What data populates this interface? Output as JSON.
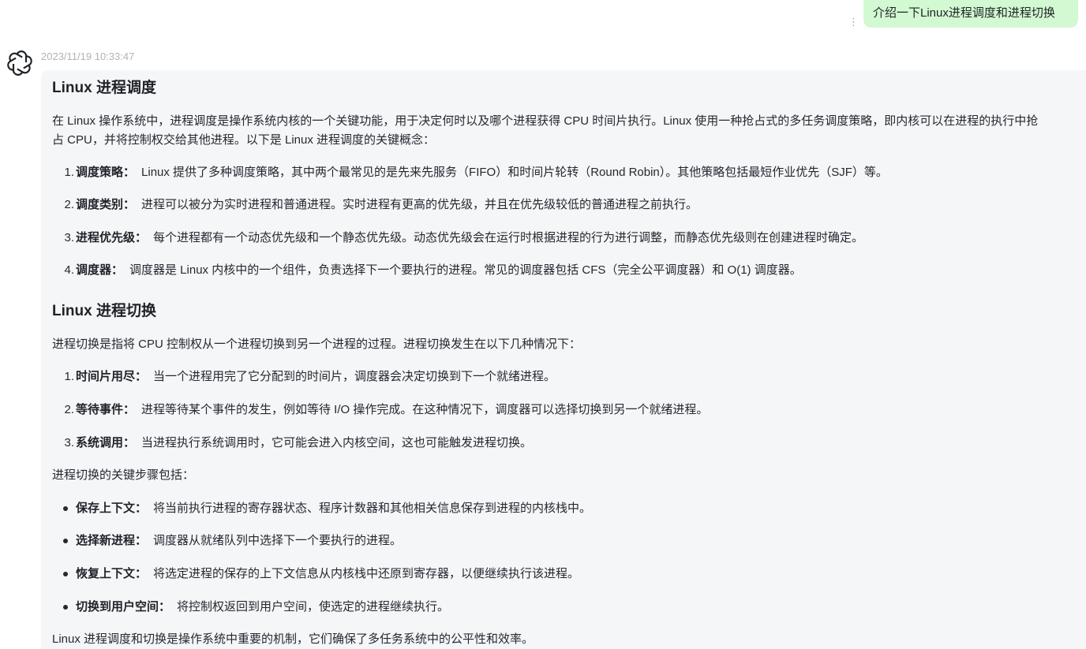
{
  "user_message": {
    "text": "介绍一下Linux进程调度和进程切换",
    "more_icon": "⋮"
  },
  "bot": {
    "timestamp": "2023/11/19 10:33:47",
    "avatar_icon": "openai-logo-icon",
    "h1": "Linux 进程调度",
    "p1_line1": "在 Linux 操作系统中，进程调度是操作系统内核的一个关键功能，用于决定何时以及哪个进程获得 CPU 时间片执行。Linux 使用一种抢占式的多任务调度策略，即内核可以在进程的执行中抢",
    "p1_line2": "占 CPU，并将控制权交给其他进程。以下是 Linux 进程调度的关键概念：",
    "list1": [
      {
        "num": "1.",
        "term": "调度策略：",
        "desc": "Linux 提供了多种调度策略，其中两个最常见的是先来先服务（FIFO）和时间片轮转（Round Robin）。其他策略包括最短作业优先（SJF）等。"
      },
      {
        "num": "2.",
        "term": "调度类别：",
        "desc": "进程可以被分为实时进程和普通进程。实时进程有更高的优先级，并且在优先级较低的普通进程之前执行。"
      },
      {
        "num": "3.",
        "term": "进程优先级：",
        "desc": "每个进程都有一个动态优先级和一个静态优先级。动态优先级会在运行时根据进程的行为进行调整，而静态优先级则在创建进程时确定。"
      },
      {
        "num": "4.",
        "term": "调度器：",
        "desc": "调度器是 Linux 内核中的一个组件，负责选择下一个要执行的进程。常见的调度器包括 CFS（完全公平调度器）和 O(1) 调度器。"
      }
    ],
    "h2": "Linux 进程切换",
    "p2": "进程切换是指将 CPU 控制权从一个进程切换到另一个进程的过程。进程切换发生在以下几种情况下：",
    "list2": [
      {
        "num": "1.",
        "term": "时间片用尽：",
        "desc": "当一个进程用完了它分配到的时间片，调度器会决定切换到下一个就绪进程。"
      },
      {
        "num": "2.",
        "term": "等待事件：",
        "desc": "进程等待某个事件的发生，例如等待 I/O 操作完成。在这种情况下，调度器可以选择切换到另一个就绪进程。"
      },
      {
        "num": "3.",
        "term": "系统调用：",
        "desc": "当进程执行系统调用时，它可能会进入内核空间，这也可能触发进程切换。"
      }
    ],
    "p3": "进程切换的关键步骤包括：",
    "list3": [
      {
        "term": "保存上下文：",
        "desc": "将当前执行进程的寄存器状态、程序计数器和其他相关信息保存到进程的内核栈中。"
      },
      {
        "term": "选择新进程：",
        "desc": "调度器从就绪队列中选择下一个要执行的进程。"
      },
      {
        "term": "恢复上下文：",
        "desc": "将选定进程的保存的上下文信息从内核栈中还原到寄存器，以便继续执行该进程。"
      },
      {
        "term": "切换到用户空间：",
        "desc": "将控制权返回到用户空间，使选定的进程继续执行。"
      }
    ],
    "p4": "Linux 进程调度和切换是操作系统中重要的机制，它们确保了多任务系统中的公平性和效率。"
  }
}
